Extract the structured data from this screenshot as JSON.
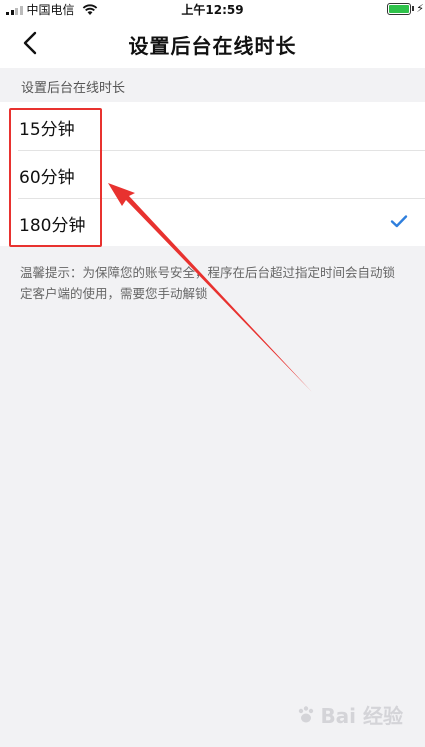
{
  "status_bar": {
    "carrier": "中国电信",
    "time": "上午12:59",
    "charging_symbol": "⚡"
  },
  "nav": {
    "back_icon": "chevron-left-icon",
    "title": "设置后台在线时长"
  },
  "section_label": "设置后台在线时长",
  "options": [
    {
      "label": "15分钟",
      "selected": false
    },
    {
      "label": "60分钟",
      "selected": false
    },
    {
      "label": "180分钟",
      "selected": true
    }
  ],
  "hint": "温馨提示：为保障您的账号安全，程序在后台超过指定时间会自动锁定客户端的使用，需要您手动解锁",
  "colors": {
    "check": "#2f7fdd",
    "annotation": "#e8322f",
    "background": "#f2f2f4"
  },
  "watermark": {
    "text": "Bai 经验",
    "icon": "paw-icon"
  }
}
